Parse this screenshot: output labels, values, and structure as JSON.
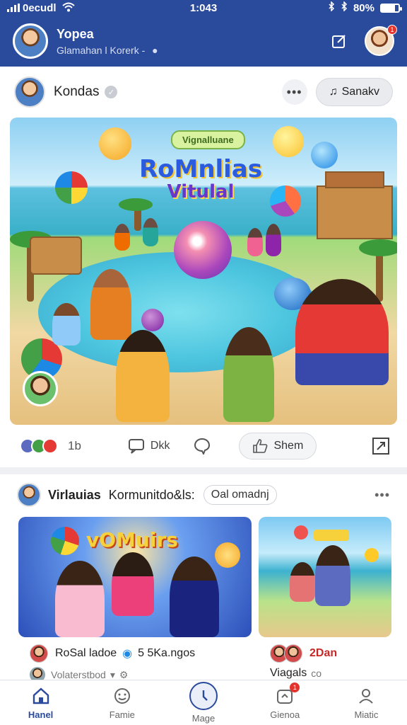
{
  "status_bar": {
    "carrier": "0ecudl",
    "time": "1:043",
    "battery": "80%",
    "battery_level": 0.8
  },
  "header": {
    "title": "Yopea",
    "subtitle": "Glamahan l Korerk -",
    "profile_badge": "1"
  },
  "post": {
    "author": "Kondas",
    "sort_button": "Sanakv",
    "image": {
      "banner": "Vignalluane",
      "title_line1": "RoMnlias",
      "title_line2": "Vitulal"
    },
    "reaction_count": "1b",
    "comment_label": "Dkk",
    "share_label": "Shem"
  },
  "post2": {
    "author": "Virlauias",
    "title": "Kormunitdo&ls:",
    "chip": "Oal omadnj",
    "tile1_title": "vOMuirs",
    "item1_name": "RoSal ladoe",
    "item1_count": "5 5Ka.ngos",
    "item1_sub": "Volaterstbod",
    "item2_name": "2Dan",
    "item2_sub": "Viagals",
    "item2_sub2": "co"
  },
  "bottom_nav": {
    "items": [
      {
        "label": "Hanel",
        "icon": "home-icon",
        "active": true
      },
      {
        "label": "Famie",
        "icon": "face-icon",
        "active": false
      },
      {
        "label": "Mage",
        "icon": "compass-icon",
        "active": false
      },
      {
        "label": "Gienoa",
        "icon": "notification-icon",
        "active": false,
        "badge": "1"
      },
      {
        "label": "Miatic",
        "icon": "person-icon",
        "active": false
      }
    ]
  },
  "colors": {
    "brand": "#2a4a9c",
    "badge": "#e2342c"
  }
}
